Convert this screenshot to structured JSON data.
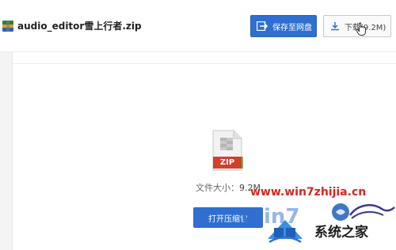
{
  "header": {
    "filename": "audio_editor雪上行者.zip",
    "save_button_label": "保存至网盘",
    "download_button_label": "下载(9.2M)"
  },
  "file": {
    "type_label": "ZIP",
    "size_label": "文件大小：",
    "size_value": "9.2M",
    "open_button_label": "打开压缩包"
  },
  "watermark": {
    "url": "www.win7zhijia.cn",
    "brand": "系统之家"
  },
  "icons": {
    "file_small": "archive-file-icon",
    "save": "save-to-cloud-icon",
    "download": "download-icon",
    "zip_file": "zip-file-icon",
    "cursor": "hand-cursor-icon",
    "watermark_logo": "system-home-logo-icon"
  },
  "colors": {
    "primary_button": "#2f6fcf",
    "zip_badge": "#d23f2a",
    "watermark_url": "#d7261e"
  }
}
